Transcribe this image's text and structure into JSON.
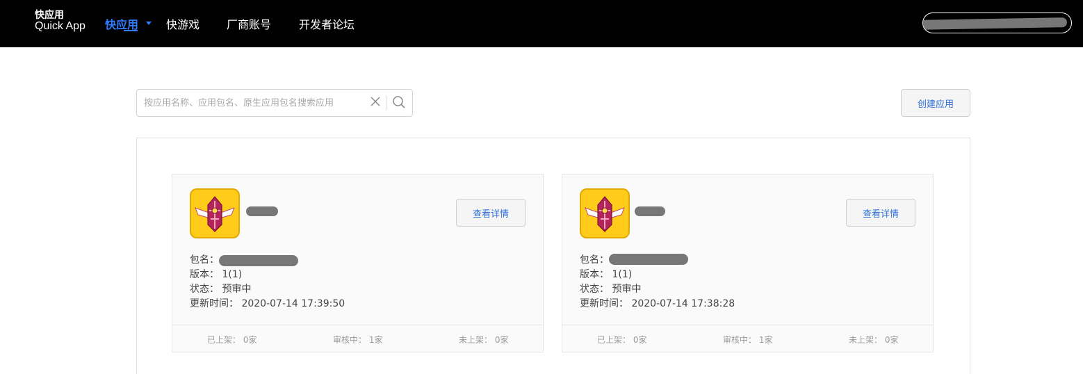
{
  "header": {
    "logo_line1": "快应用",
    "logo_line2": "Quick App",
    "nav": [
      {
        "label": "快应用",
        "active": true
      },
      {
        "label": "快游戏",
        "active": false
      },
      {
        "label": "厂商账号",
        "active": false
      },
      {
        "label": "开发者论坛",
        "active": false
      }
    ]
  },
  "search": {
    "placeholder": "按应用名称、应用包名、原生应用包名搜索应用",
    "value": ""
  },
  "create_button": "创建应用",
  "labels": {
    "package": "包名：",
    "version": "版本：",
    "status": "状态：",
    "updated": "更新时间：",
    "detail_button": "查看详情"
  },
  "apps": [
    {
      "version": "1(1)",
      "status": "预审中",
      "updated": "2020-07-14 17:39:50",
      "stats": {
        "listed": "已上架： 0家",
        "reviewing": "审核中： 1家",
        "unlisted": "未上架： 0家"
      }
    },
    {
      "version": "1(1)",
      "status": "预审中",
      "updated": "2020-07-14 17:38:28",
      "stats": {
        "listed": "已上架： 0家",
        "reviewing": "审核中： 1家",
        "unlisted": "未上架： 0家"
      }
    }
  ],
  "colors": {
    "accent": "#2f7dff",
    "header_bg": "#000000",
    "icon_bg": "#ffcc1a"
  }
}
